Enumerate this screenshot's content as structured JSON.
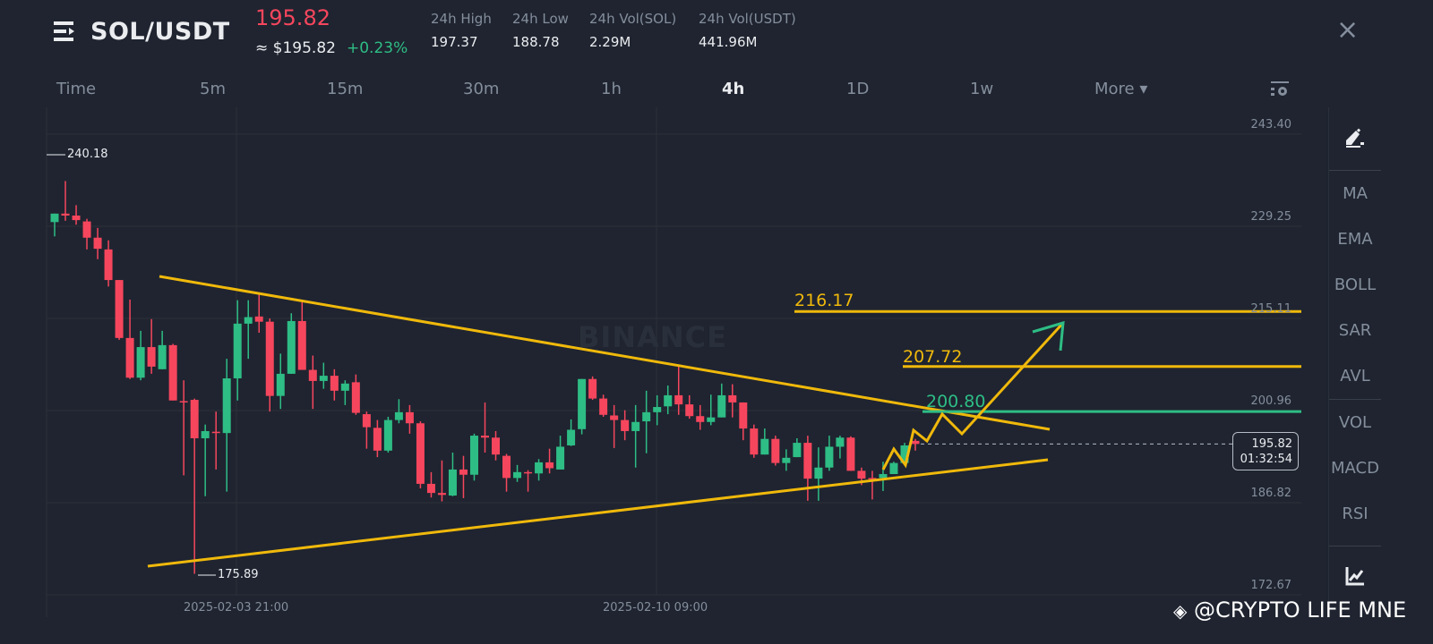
{
  "header": {
    "pair": "SOL/USDT",
    "last_price": "195.82",
    "approx_usd": "≈ $195.82",
    "change_pct": "+0.23%",
    "stats": [
      {
        "label": "24h High",
        "value": "197.37"
      },
      {
        "label": "24h Low",
        "value": "188.78"
      },
      {
        "label": "24h Vol(SOL)",
        "value": "2.29M"
      },
      {
        "label": "24h Vol(USDT)",
        "value": "441.96M"
      }
    ],
    "close_icon": "×"
  },
  "intervals": [
    {
      "label": "Time",
      "active": false
    },
    {
      "label": "5m",
      "active": false
    },
    {
      "label": "15m",
      "active": false
    },
    {
      "label": "30m",
      "active": false
    },
    {
      "label": "1h",
      "active": false
    },
    {
      "label": "4h",
      "active": true
    },
    {
      "label": "1D",
      "active": false
    },
    {
      "label": "1w",
      "active": false
    },
    {
      "label": "More ▾",
      "active": false
    }
  ],
  "sidebar": {
    "indicators_main": [
      "MA",
      "EMA",
      "BOLL",
      "SAR",
      "AVL"
    ],
    "indicators_sub": [
      "VOL",
      "MACD",
      "RSI"
    ]
  },
  "colors": {
    "up": "#2ebd85",
    "down": "#f6465d",
    "drawing": "#f0b90b",
    "background": "#1f2430"
  },
  "watermark": "BINANCE",
  "credit": "@CRYPTO LIFE MNE",
  "chart_data": {
    "type": "candlestick",
    "symbol": "SOL/USDT",
    "interval": "4h",
    "y_ticks": [
      "243.40",
      "229.25",
      "215.11",
      "200.96",
      "186.82",
      "172.67"
    ],
    "ylim": [
      172.67,
      243.4
    ],
    "x_ticks": [
      "2025-02-03 21:00",
      "2025-02-10 09:00"
    ],
    "max_marker": "240.18",
    "min_marker": "175.89",
    "current_price": "195.82",
    "countdown": "01:32:54",
    "levels": [
      {
        "label": "216.17",
        "price": 216.17,
        "color": "#f0b90b"
      },
      {
        "label": "207.72",
        "price": 207.72,
        "color": "#f0b90b"
      },
      {
        "label": "200.80",
        "price": 200.8,
        "color": "#2ebd85"
      }
    ],
    "candles": [
      [
        229.9,
        231.2,
        231.2,
        227.7
      ],
      [
        231.2,
        230.9,
        236.2,
        230.1
      ],
      [
        230.9,
        230.2,
        232.5,
        229.5
      ],
      [
        230.0,
        227.5,
        230.4,
        225.7
      ],
      [
        227.5,
        225.8,
        229.0,
        224.2
      ],
      [
        225.7,
        221.0,
        227.1,
        220.0
      ],
      [
        221.0,
        212.1,
        221.0,
        211.8
      ],
      [
        212.1,
        206.0,
        218.0,
        205.8
      ],
      [
        206.0,
        210.7,
        213.2,
        205.6
      ],
      [
        210.7,
        207.7,
        215.0,
        206.6
      ],
      [
        207.3,
        211.0,
        213.2,
        207.3
      ],
      [
        211.0,
        202.5,
        211.2,
        202.5
      ],
      [
        202.4,
        202.3,
        205.6,
        191.0
      ],
      [
        202.6,
        196.7,
        202.8,
        175.89
      ],
      [
        196.7,
        197.8,
        198.8,
        187.8
      ],
      [
        197.7,
        197.6,
        200.8,
        191.9
      ],
      [
        197.5,
        205.9,
        208.9,
        188.5
      ],
      [
        205.9,
        214.3,
        217.9,
        202.5
      ],
      [
        214.3,
        215.3,
        217.9,
        208.9
      ],
      [
        215.4,
        214.6,
        219.1,
        212.9
      ],
      [
        214.6,
        203.2,
        215.1,
        200.8
      ],
      [
        203.2,
        206.6,
        209.7,
        201.2
      ],
      [
        206.6,
        214.7,
        215.9,
        206.6
      ],
      [
        214.7,
        207.2,
        217.6,
        207.2
      ],
      [
        207.2,
        205.5,
        209.4,
        201.2
      ],
      [
        205.5,
        206.3,
        208.3,
        204.3
      ],
      [
        206.3,
        204.0,
        207.3,
        202.5
      ],
      [
        204.0,
        205.1,
        205.6,
        201.8
      ],
      [
        205.3,
        200.6,
        206.5,
        200.3
      ],
      [
        200.4,
        198.4,
        200.8,
        195.1
      ],
      [
        198.3,
        194.8,
        199.5,
        193.8
      ],
      [
        194.8,
        199.5,
        200.0,
        194.5
      ],
      [
        199.5,
        200.7,
        202.7,
        199.0
      ],
      [
        200.7,
        199.0,
        201.8,
        197.4
      ],
      [
        199.0,
        189.7,
        199.3,
        189.0
      ],
      [
        189.7,
        188.3,
        191.5,
        187.6
      ],
      [
        188.3,
        188.0,
        193.3,
        187.0
      ],
      [
        187.9,
        191.9,
        194.5,
        187.8
      ],
      [
        191.9,
        191.1,
        194.0,
        187.5
      ],
      [
        191.1,
        197.1,
        197.4,
        190.2
      ],
      [
        197.1,
        196.8,
        202.2,
        194.5
      ],
      [
        196.8,
        194.2,
        197.8,
        193.3
      ],
      [
        194.0,
        190.6,
        194.3,
        188.5
      ],
      [
        190.6,
        191.5,
        192.6,
        190.0
      ],
      [
        191.5,
        191.3,
        191.8,
        188.5
      ],
      [
        191.3,
        193.0,
        193.5,
        190.2
      ],
      [
        193.0,
        192.1,
        195.1,
        191.3
      ],
      [
        191.9,
        195.4,
        197.1,
        191.9
      ],
      [
        195.6,
        198.0,
        199.6,
        195.5
      ],
      [
        198.1,
        205.8,
        205.8,
        197.3
      ],
      [
        205.8,
        202.8,
        206.2,
        202.6
      ],
      [
        202.8,
        200.3,
        203.4,
        200.0
      ],
      [
        200.2,
        199.5,
        201.8,
        195.2
      ],
      [
        199.5,
        197.8,
        201.0,
        196.4
      ],
      [
        197.8,
        199.2,
        201.8,
        192.2
      ],
      [
        199.3,
        200.7,
        204.0,
        194.4
      ],
      [
        200.7,
        201.5,
        203.3,
        198.7
      ],
      [
        201.6,
        203.3,
        204.8,
        200.4
      ],
      [
        203.3,
        201.9,
        208.0,
        200.3
      ],
      [
        201.9,
        200.1,
        203.3,
        199.7
      ],
      [
        200.1,
        199.2,
        201.8,
        198.0
      ],
      [
        199.2,
        199.9,
        203.4,
        198.7
      ],
      [
        199.9,
        203.3,
        205.1,
        199.9
      ],
      [
        203.3,
        202.2,
        205.0,
        199.9
      ],
      [
        202.2,
        198.2,
        202.2,
        196.4
      ],
      [
        198.2,
        194.2,
        198.8,
        193.7
      ],
      [
        194.2,
        196.6,
        198.2,
        194.2
      ],
      [
        196.6,
        192.9,
        197.1,
        192.5
      ],
      [
        192.9,
        193.7,
        195.0,
        191.7
      ],
      [
        193.8,
        196.0,
        196.7,
        193.8
      ],
      [
        196.0,
        190.5,
        197.1,
        187.1
      ],
      [
        190.5,
        192.2,
        195.3,
        187.1
      ],
      [
        192.2,
        195.4,
        197.1,
        191.7
      ],
      [
        195.4,
        196.8,
        197.1,
        193.6
      ],
      [
        196.8,
        191.7,
        197.0,
        191.7
      ],
      [
        191.7,
        190.5,
        192.2,
        189.5
      ],
      [
        190.6,
        190.5,
        191.7,
        187.3
      ],
      [
        190.6,
        191.2,
        193.1,
        188.6
      ],
      [
        191.2,
        192.9,
        193.1,
        191.2
      ],
      [
        192.9,
        195.6,
        196.0,
        192.6
      ],
      [
        196.3,
        195.82,
        196.6,
        194.8
      ]
    ]
  }
}
